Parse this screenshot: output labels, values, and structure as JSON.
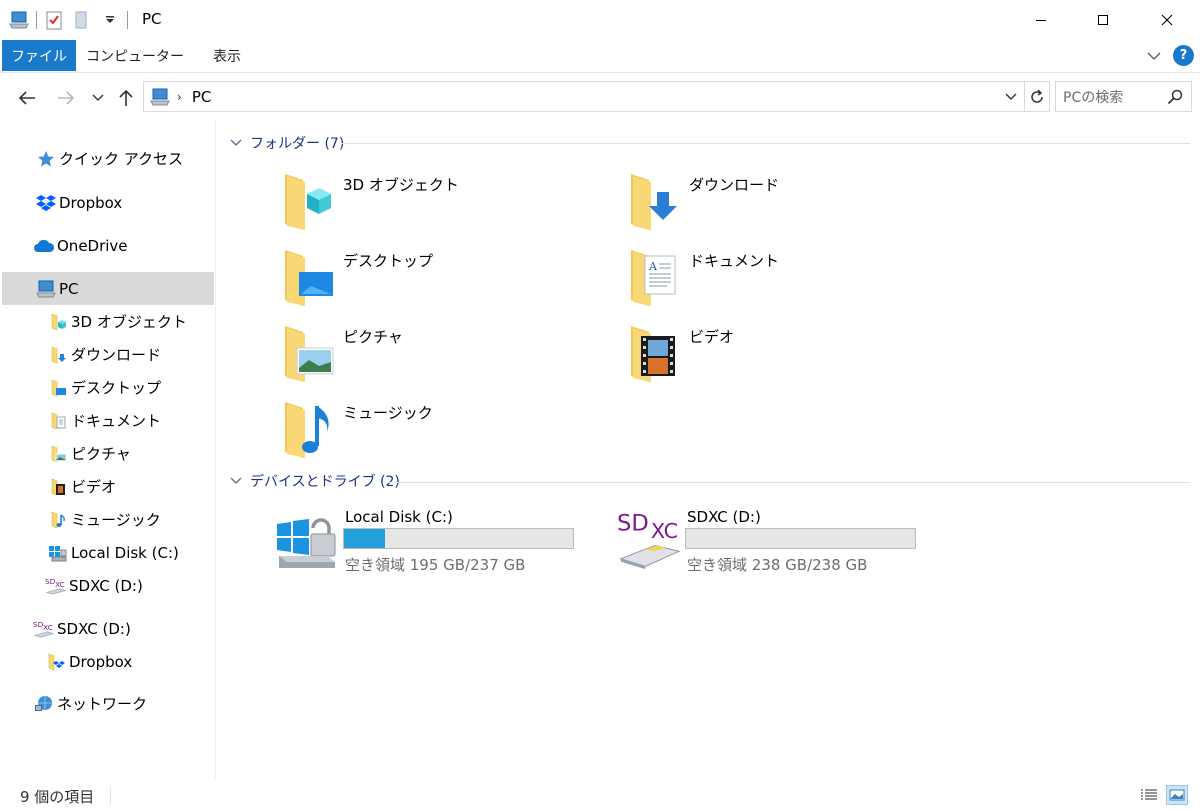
{
  "window": {
    "title": "PC",
    "minimize_glyph": "—",
    "close_glyph": "✕"
  },
  "ribbon": {
    "tabs": [
      "ファイル",
      "コンピューター",
      "表示"
    ],
    "help_label": "?"
  },
  "address_bar": {
    "crumb_separator": "›",
    "crumb": "PC"
  },
  "search": {
    "placeholder": "PCの検索"
  },
  "sidebar": {
    "items": [
      {
        "label": "クイック アクセス",
        "icon": "star-icon"
      },
      {
        "label": "Dropbox",
        "icon": "dropbox-icon"
      },
      {
        "label": "OneDrive",
        "icon": "onedrive-cloud-icon"
      },
      {
        "label": "PC",
        "icon": "pc-icon",
        "selected": true
      },
      {
        "label": "3D オブジェクト",
        "icon": "folder-3d-icon"
      },
      {
        "label": "ダウンロード",
        "icon": "folder-download-icon"
      },
      {
        "label": "デスクトップ",
        "icon": "folder-desktop-icon"
      },
      {
        "label": "ドキュメント",
        "icon": "folder-documents-icon"
      },
      {
        "label": "ピクチャ",
        "icon": "folder-pictures-icon"
      },
      {
        "label": "ビデオ",
        "icon": "folder-videos-icon"
      },
      {
        "label": "ミュージック",
        "icon": "folder-music-icon"
      },
      {
        "label": "Local Disk (C:)",
        "icon": "system-drive-icon"
      },
      {
        "label": "SDXC (D:)",
        "icon": "sdxc-drive-icon"
      },
      {
        "label": "SDXC (D:)",
        "icon": "sdxc-drive-icon"
      },
      {
        "label": "Dropbox",
        "icon": "dropbox-folder-icon"
      },
      {
        "label": "ネットワーク",
        "icon": "network-icon"
      }
    ]
  },
  "content": {
    "folders_header": "フォルダー (7)",
    "folders": [
      {
        "label": "3D オブジェクト",
        "icon": "folder-3d-icon"
      },
      {
        "label": "ダウンロード",
        "icon": "folder-download-icon"
      },
      {
        "label": "デスクトップ",
        "icon": "folder-desktop-icon"
      },
      {
        "label": "ドキュメント",
        "icon": "folder-documents-icon"
      },
      {
        "label": "ピクチャ",
        "icon": "folder-pictures-icon"
      },
      {
        "label": "ビデオ",
        "icon": "folder-videos-icon"
      },
      {
        "label": "ミュージック",
        "icon": "folder-music-icon"
      }
    ],
    "drives_header": "デバイスとドライブ (2)",
    "drives": [
      {
        "label": "Local Disk (C:)",
        "free_text": "空き領域 195 GB/237 GB",
        "used_fraction": 0.177,
        "icon": "system-drive-icon"
      },
      {
        "label": "SDXC (D:)",
        "free_text": "空き領域 238 GB/238 GB",
        "used_fraction": 0.0,
        "icon": "sdxc-drive-icon",
        "logo_text": "SD XC"
      }
    ]
  },
  "status": {
    "item_count": "9 個の項目"
  },
  "colors": {
    "accent": "#1979ca",
    "folder_yellow": "#f8d775",
    "usage_bar": "#26a0da",
    "group_header": "#1e3287",
    "sd_purple": "#7b1a8c"
  }
}
